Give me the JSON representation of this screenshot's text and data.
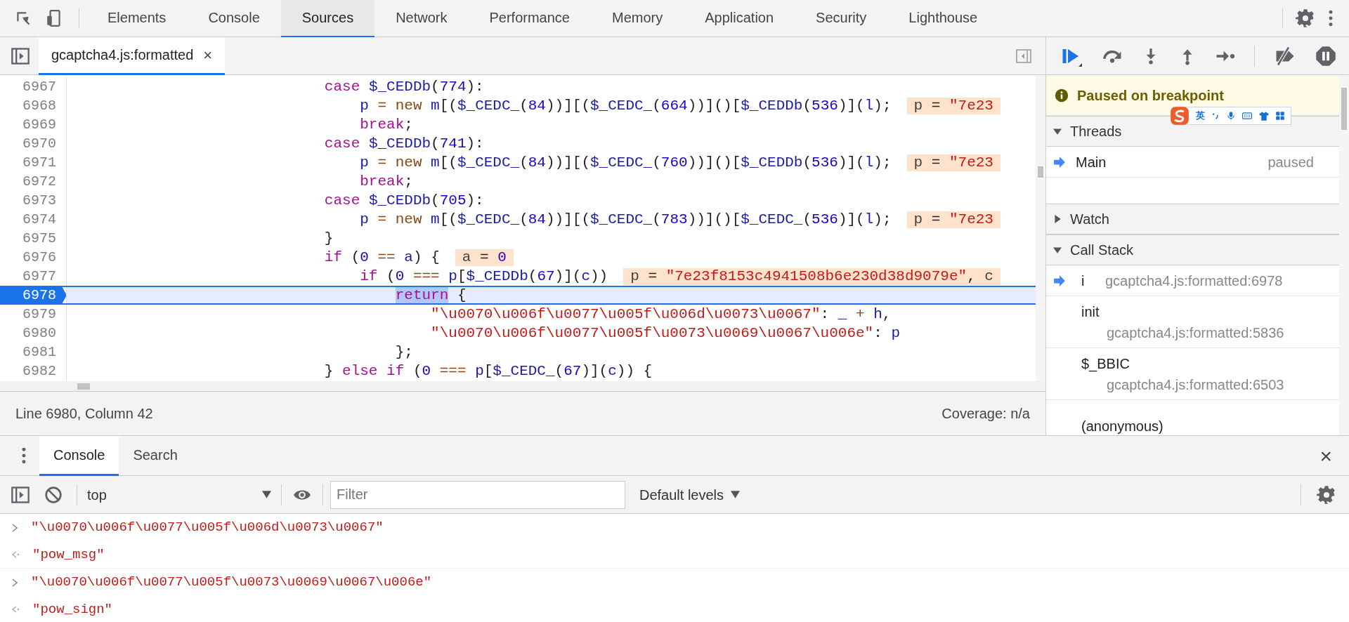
{
  "top_tabs": [
    {
      "label": "Elements",
      "selected": false
    },
    {
      "label": "Console",
      "selected": false
    },
    {
      "label": "Sources",
      "selected": true
    },
    {
      "label": "Network",
      "selected": false
    },
    {
      "label": "Performance",
      "selected": false
    },
    {
      "label": "Memory",
      "selected": false
    },
    {
      "label": "Application",
      "selected": false
    },
    {
      "label": "Security",
      "selected": false
    },
    {
      "label": "Lighthouse",
      "selected": false
    }
  ],
  "file_tabs": [
    {
      "label": "gcaptcha4.js:formatted",
      "selected": true,
      "close": "×"
    }
  ],
  "editor": {
    "lines": [
      {
        "number": "6967",
        "current": false,
        "tokens": [
          {
            "kind": "kw",
            "text": "                            case "
          },
          {
            "kind": "id",
            "text": "$_CEDDb"
          },
          {
            "kind": "punct",
            "text": "("
          },
          {
            "kind": "num",
            "text": "774"
          },
          {
            "kind": "punct",
            "text": "):"
          }
        ]
      },
      {
        "number": "6968",
        "current": false,
        "tokens": [
          {
            "kind": "id",
            "text": "                                p"
          },
          {
            "kind": "op",
            "text": " = new "
          },
          {
            "kind": "id",
            "text": "m"
          },
          {
            "kind": "punct",
            "text": "[("
          },
          {
            "kind": "id",
            "text": "$_CEDC_"
          },
          {
            "kind": "punct",
            "text": "("
          },
          {
            "kind": "num",
            "text": "84"
          },
          {
            "kind": "punct",
            "text": "))][("
          },
          {
            "kind": "id",
            "text": "$_CEDC_"
          },
          {
            "kind": "punct",
            "text": "("
          },
          {
            "kind": "num",
            "text": "664"
          },
          {
            "kind": "punct",
            "text": "))]()["
          },
          {
            "kind": "id",
            "text": "$_CEDDb"
          },
          {
            "kind": "punct",
            "text": "("
          },
          {
            "kind": "num",
            "text": "536"
          },
          {
            "kind": "punct",
            "text": ")]("
          },
          {
            "kind": "id",
            "text": "l"
          },
          {
            "kind": "punct",
            "text": ");"
          }
        ],
        "inline_value": [
          {
            "kind": "name",
            "text": "p"
          },
          {
            "kind": "punct",
            "text": " = "
          },
          {
            "kind": "str",
            "text": "\"7e23"
          }
        ]
      },
      {
        "number": "6969",
        "current": false,
        "tokens": [
          {
            "kind": "kw",
            "text": "                                break"
          },
          {
            "kind": "punct",
            "text": ";"
          }
        ]
      },
      {
        "number": "6970",
        "current": false,
        "tokens": [
          {
            "kind": "kw",
            "text": "                            case "
          },
          {
            "kind": "id",
            "text": "$_CEDDb"
          },
          {
            "kind": "punct",
            "text": "("
          },
          {
            "kind": "num",
            "text": "741"
          },
          {
            "kind": "punct",
            "text": "):"
          }
        ]
      },
      {
        "number": "6971",
        "current": false,
        "tokens": [
          {
            "kind": "id",
            "text": "                                p"
          },
          {
            "kind": "op",
            "text": " = new "
          },
          {
            "kind": "id",
            "text": "m"
          },
          {
            "kind": "punct",
            "text": "[("
          },
          {
            "kind": "id",
            "text": "$_CEDC_"
          },
          {
            "kind": "punct",
            "text": "("
          },
          {
            "kind": "num",
            "text": "84"
          },
          {
            "kind": "punct",
            "text": "))][("
          },
          {
            "kind": "id",
            "text": "$_CEDC_"
          },
          {
            "kind": "punct",
            "text": "("
          },
          {
            "kind": "num",
            "text": "760"
          },
          {
            "kind": "punct",
            "text": "))]()["
          },
          {
            "kind": "id",
            "text": "$_CEDDb"
          },
          {
            "kind": "punct",
            "text": "("
          },
          {
            "kind": "num",
            "text": "536"
          },
          {
            "kind": "punct",
            "text": ")]("
          },
          {
            "kind": "id",
            "text": "l"
          },
          {
            "kind": "punct",
            "text": ");"
          }
        ],
        "inline_value": [
          {
            "kind": "name",
            "text": "p"
          },
          {
            "kind": "punct",
            "text": " = "
          },
          {
            "kind": "str",
            "text": "\"7e23"
          }
        ]
      },
      {
        "number": "6972",
        "current": false,
        "tokens": [
          {
            "kind": "kw",
            "text": "                                break"
          },
          {
            "kind": "punct",
            "text": ";"
          }
        ]
      },
      {
        "number": "6973",
        "current": false,
        "tokens": [
          {
            "kind": "kw",
            "text": "                            case "
          },
          {
            "kind": "id",
            "text": "$_CEDDb"
          },
          {
            "kind": "punct",
            "text": "("
          },
          {
            "kind": "num",
            "text": "705"
          },
          {
            "kind": "punct",
            "text": "):"
          }
        ]
      },
      {
        "number": "6974",
        "current": false,
        "tokens": [
          {
            "kind": "id",
            "text": "                                p"
          },
          {
            "kind": "op",
            "text": " = new "
          },
          {
            "kind": "id",
            "text": "m"
          },
          {
            "kind": "punct",
            "text": "[("
          },
          {
            "kind": "id",
            "text": "$_CEDC_"
          },
          {
            "kind": "punct",
            "text": "("
          },
          {
            "kind": "num",
            "text": "84"
          },
          {
            "kind": "punct",
            "text": "))][("
          },
          {
            "kind": "id",
            "text": "$_CEDC_"
          },
          {
            "kind": "punct",
            "text": "("
          },
          {
            "kind": "num",
            "text": "783"
          },
          {
            "kind": "punct",
            "text": "))]()["
          },
          {
            "kind": "id",
            "text": "$_CEDC_"
          },
          {
            "kind": "punct",
            "text": "("
          },
          {
            "kind": "num",
            "text": "536"
          },
          {
            "kind": "punct",
            "text": ")]("
          },
          {
            "kind": "id",
            "text": "l"
          },
          {
            "kind": "punct",
            "text": ");"
          }
        ],
        "inline_value": [
          {
            "kind": "name",
            "text": "p"
          },
          {
            "kind": "punct",
            "text": " = "
          },
          {
            "kind": "str",
            "text": "\"7e23"
          }
        ]
      },
      {
        "number": "6975",
        "current": false,
        "tokens": [
          {
            "kind": "punct",
            "text": "                            }"
          }
        ]
      },
      {
        "number": "6976",
        "current": false,
        "tokens": [
          {
            "kind": "kw",
            "text": "                            if"
          },
          {
            "kind": "punct",
            "text": " ("
          },
          {
            "kind": "num",
            "text": "0"
          },
          {
            "kind": "op",
            "text": " == "
          },
          {
            "kind": "id",
            "text": "a"
          },
          {
            "kind": "punct",
            "text": ") {"
          }
        ],
        "inline_value": [
          {
            "kind": "name",
            "text": "a"
          },
          {
            "kind": "punct",
            "text": " = "
          },
          {
            "kind": "num",
            "text": "0"
          }
        ]
      },
      {
        "number": "6977",
        "current": false,
        "tokens": [
          {
            "kind": "kw",
            "text": "                                if"
          },
          {
            "kind": "punct",
            "text": " ("
          },
          {
            "kind": "num",
            "text": "0"
          },
          {
            "kind": "op",
            "text": " === "
          },
          {
            "kind": "id",
            "text": "p"
          },
          {
            "kind": "punct",
            "text": "["
          },
          {
            "kind": "id",
            "text": "$_CEDDb"
          },
          {
            "kind": "punct",
            "text": "("
          },
          {
            "kind": "num",
            "text": "67"
          },
          {
            "kind": "punct",
            "text": ")]("
          },
          {
            "kind": "id",
            "text": "c"
          },
          {
            "kind": "punct",
            "text": "))"
          }
        ],
        "inline_value": [
          {
            "kind": "name",
            "text": "p"
          },
          {
            "kind": "punct",
            "text": " = "
          },
          {
            "kind": "str",
            "text": "\"7e23f8153c4941508b6e230d38d9079e\""
          },
          {
            "kind": "punct",
            "text": ", "
          },
          {
            "kind": "name",
            "text": "c"
          }
        ]
      },
      {
        "number": "6978",
        "current": true,
        "tokens": [
          {
            "kind": "indent_selection",
            "text": "                                    return"
          },
          {
            "kind": "punct",
            "text": " {"
          }
        ]
      },
      {
        "number": "6979",
        "current": false,
        "tokens": [
          {
            "kind": "str",
            "text": "                                        \"\\u0070\\u006f\\u0077\\u005f\\u006d\\u0073\\u0067\""
          },
          {
            "kind": "punct",
            "text": ": "
          },
          {
            "kind": "id",
            "text": "_"
          },
          {
            "kind": "op",
            "text": " + "
          },
          {
            "kind": "id",
            "text": "h"
          },
          {
            "kind": "punct",
            "text": ","
          }
        ]
      },
      {
        "number": "6980",
        "current": false,
        "tokens": [
          {
            "kind": "str",
            "text": "                                        \"\\u0070\\u006f\\u0077\\u005f\\u0073\\u0069\\u0067\\u006e\""
          },
          {
            "kind": "punct",
            "text": ": "
          },
          {
            "kind": "id",
            "text": "p"
          }
        ]
      },
      {
        "number": "6981",
        "current": false,
        "tokens": [
          {
            "kind": "punct",
            "text": "                                    };"
          }
        ]
      },
      {
        "number": "6982",
        "current": false,
        "tokens": [
          {
            "kind": "punct",
            "text": "                            } "
          },
          {
            "kind": "kw",
            "text": "else if"
          },
          {
            "kind": "punct",
            "text": " ("
          },
          {
            "kind": "num",
            "text": "0"
          },
          {
            "kind": "op",
            "text": " === "
          },
          {
            "kind": "id",
            "text": "p"
          },
          {
            "kind": "punct",
            "text": "["
          },
          {
            "kind": "id",
            "text": "$_CEDC_"
          },
          {
            "kind": "punct",
            "text": "("
          },
          {
            "kind": "num",
            "text": "67"
          },
          {
            "kind": "punct",
            "text": ")]("
          },
          {
            "kind": "id",
            "text": "c"
          },
          {
            "kind": "punct",
            "text": ")) {"
          }
        ]
      }
    ]
  },
  "status_bar": {
    "position": "Line 6980, Column 42",
    "coverage": "Coverage: n/a"
  },
  "debugger": {
    "banner": "Paused on breakpoint",
    "ime_toolbar": {
      "mode": "英"
    },
    "sections": [
      {
        "title": "Threads",
        "expanded": true,
        "kind": "threads",
        "items": [
          {
            "name": "Main",
            "status": "paused",
            "current": true
          }
        ]
      },
      {
        "title": "Watch",
        "expanded": false,
        "kind": "watch"
      },
      {
        "title": "Call Stack",
        "expanded": true,
        "kind": "callstack",
        "items": [
          {
            "name": "i",
            "location": "gcaptcha4.js:formatted:6978",
            "current": true
          },
          {
            "name": "init",
            "location": "gcaptcha4.js:formatted:5836",
            "current": false
          },
          {
            "name": "$_BBIC",
            "location": "gcaptcha4.js:formatted:6503",
            "current": false
          },
          {
            "name": "(anonymous)",
            "current": false
          }
        ]
      }
    ]
  },
  "drawer": {
    "tabs": [
      {
        "label": "Console",
        "selected": true
      },
      {
        "label": "Search",
        "selected": false
      }
    ],
    "close": "×",
    "context": "top",
    "filter_placeholder": "Filter",
    "levels": "Default levels",
    "messages": [
      {
        "kind": "input",
        "text": "\"\\u0070\\u006f\\u0077\\u005f\\u006d\\u0073\\u0067\""
      },
      {
        "kind": "output",
        "text": "\"pow_msg\""
      },
      {
        "kind": "input",
        "text": "\"\\u0070\\u006f\\u0077\\u005f\\u0073\\u0069\\u0067\\u006e\""
      },
      {
        "kind": "output",
        "text": "\"pow_sign\""
      }
    ]
  }
}
